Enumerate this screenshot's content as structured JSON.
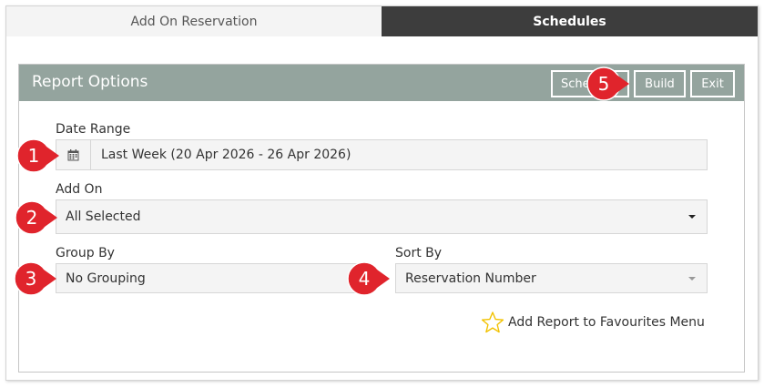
{
  "tabs": [
    {
      "label": "Add On Reservation",
      "active": false
    },
    {
      "label": "Schedules",
      "active": true
    }
  ],
  "panel": {
    "title": "Report Options",
    "buttons": {
      "schedule": "Schedule",
      "build": "Build",
      "exit": "Exit"
    }
  },
  "date_range": {
    "label": "Date Range",
    "value": "Last Week (20 Apr 2026 - 26 Apr 2026)",
    "icon": "calendar-icon"
  },
  "add_on": {
    "label": "Add On",
    "value": "All Selected"
  },
  "group_by": {
    "label": "Group By",
    "value": "No Grouping"
  },
  "sort_by": {
    "label": "Sort By",
    "value": "Reservation Number"
  },
  "favourites": {
    "label": "Add Report to Favourites Menu",
    "icon": "star-outline-icon"
  },
  "callouts": [
    "1",
    "2",
    "3",
    "4",
    "5"
  ],
  "colors": {
    "header": "#94a49e",
    "active_tab": "#3d3d3d",
    "callout": "#e0242c",
    "star": "#f2c200"
  }
}
